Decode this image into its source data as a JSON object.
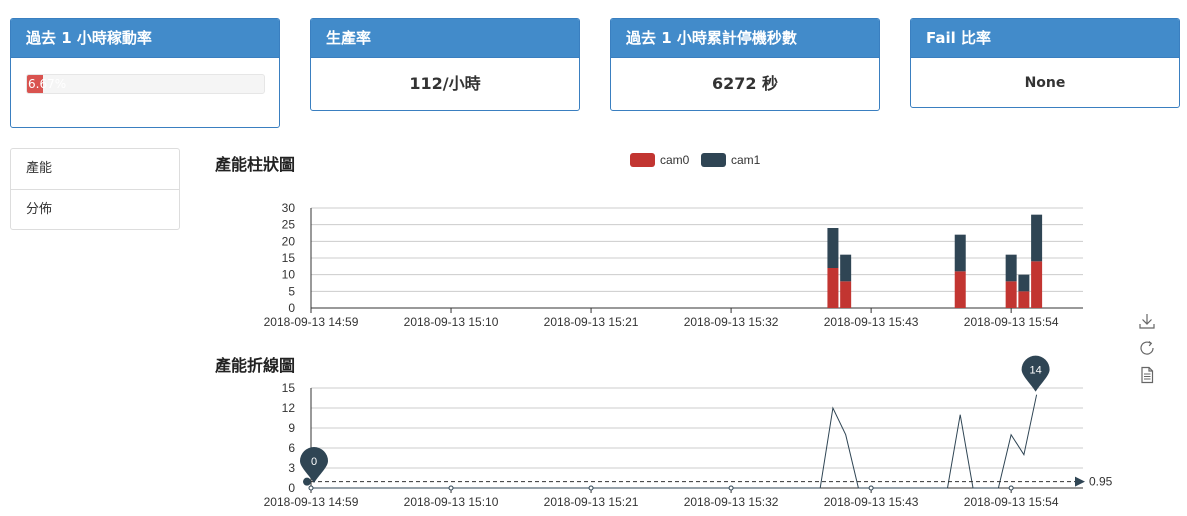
{
  "cards": {
    "uptime": {
      "title": "過去 1 小時稼動率",
      "percent_text": "6.67%",
      "percent": 6.67
    },
    "production_rate": {
      "title": "生產率",
      "value": "112/小時"
    },
    "downtime": {
      "title": "過去 1 小時累計停機秒數",
      "value": "6272 秒"
    },
    "fail_rate": {
      "title": "Fail 比率",
      "value": "None"
    }
  },
  "nav": {
    "items": [
      {
        "label": "產能"
      },
      {
        "label": "分佈"
      }
    ]
  },
  "bar_section": {
    "title": "產能柱狀圖"
  },
  "line_section": {
    "title": "產能折線圖"
  },
  "colors": {
    "cam0": "#c23531",
    "cam1": "#2f4554",
    "header": "#428bca"
  },
  "toolbox": {
    "icons": [
      "download-icon",
      "refresh-icon",
      "data-view-icon"
    ]
  },
  "chart_data": [
    {
      "type": "bar",
      "stacked": true,
      "legend": [
        "cam0",
        "cam1"
      ],
      "legend_position": "top-center",
      "xlabels": [
        "2018-09-13 14:59",
        "2018-09-13 15:10",
        "2018-09-13 15:21",
        "2018-09-13 15:32",
        "2018-09-13 15:43",
        "2018-09-13 15:54"
      ],
      "ylim": [
        0,
        30
      ],
      "yticks": [
        0,
        5,
        10,
        15,
        20,
        25,
        30
      ],
      "grid": true,
      "bars": [
        {
          "minute": "15:40",
          "cam0": 12,
          "cam1": 12
        },
        {
          "minute": "15:41",
          "cam0": 8,
          "cam1": 8
        },
        {
          "minute": "15:50",
          "cam0": 11,
          "cam1": 11
        },
        {
          "minute": "15:54",
          "cam0": 8,
          "cam1": 8
        },
        {
          "minute": "15:55",
          "cam0": 5,
          "cam1": 5
        },
        {
          "minute": "15:56",
          "cam0": 14,
          "cam1": 14
        }
      ]
    },
    {
      "type": "line",
      "xlabels": [
        "2018-09-13 14:59",
        "2018-09-13 15:10",
        "2018-09-13 15:21",
        "2018-09-13 15:32",
        "2018-09-13 15:43",
        "2018-09-13 15:54"
      ],
      "ylim": [
        0,
        15
      ],
      "yticks": [
        0,
        3,
        6,
        9,
        12,
        15
      ],
      "grid": true,
      "points": [
        {
          "minute": "15:39",
          "value": 0
        },
        {
          "minute": "15:40",
          "value": 12
        },
        {
          "minute": "15:41",
          "value": 8
        },
        {
          "minute": "15:42",
          "value": 0
        },
        {
          "minute": "15:49",
          "value": 0
        },
        {
          "minute": "15:50",
          "value": 11
        },
        {
          "minute": "15:51",
          "value": 0
        },
        {
          "minute": "15:53",
          "value": 0
        },
        {
          "minute": "15:54",
          "value": 8
        },
        {
          "minute": "15:55",
          "value": 5
        },
        {
          "minute": "15:56",
          "value": 14
        }
      ],
      "min_marker": {
        "label": "0"
      },
      "max_marker": {
        "label": "14"
      },
      "mark_line": {
        "value": 0.95,
        "label": "0.95"
      }
    }
  ]
}
